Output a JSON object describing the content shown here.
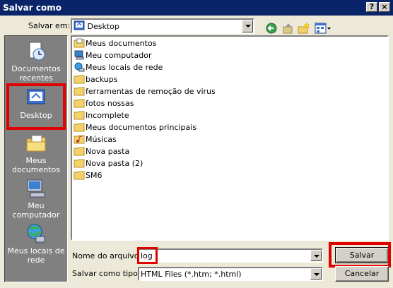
{
  "window": {
    "title": "Salvar como",
    "help_label": "?",
    "close_label": "×"
  },
  "savein": {
    "label": "Salvar em:",
    "value": "Desktop",
    "value_icon": "desktop-icon"
  },
  "toolbar": {
    "icons": [
      "back-icon",
      "up-folder-icon",
      "new-folder-icon",
      "view-menu-icon"
    ]
  },
  "places": [
    {
      "label": "Documentos recentes",
      "icon": "recent-documents-icon"
    },
    {
      "label": "Desktop",
      "icon": "desktop-icon"
    },
    {
      "label": "Meus documentos",
      "icon": "my-documents-icon"
    },
    {
      "label": "Meu computador",
      "icon": "my-computer-icon"
    },
    {
      "label": "Meus locais de rede",
      "icon": "network-places-icon"
    }
  ],
  "files": [
    {
      "name": "Meus documentos",
      "icon": "my-documents-icon"
    },
    {
      "name": "Meu computador",
      "icon": "my-computer-icon"
    },
    {
      "name": "Meus locais de rede",
      "icon": "network-places-icon"
    },
    {
      "name": "backups",
      "icon": "folder-icon"
    },
    {
      "name": "ferramentas de remoção de virus",
      "icon": "folder-icon"
    },
    {
      "name": "fotos nossas",
      "icon": "folder-icon"
    },
    {
      "name": "Incomplete",
      "icon": "folder-icon"
    },
    {
      "name": "Meus documentos principais",
      "icon": "folder-icon"
    },
    {
      "name": "Músicas",
      "icon": "music-folder-icon"
    },
    {
      "name": "Nova pasta",
      "icon": "folder-icon"
    },
    {
      "name": "Nova pasta (2)",
      "icon": "folder-icon"
    },
    {
      "name": "SM6",
      "icon": "folder-icon"
    }
  ],
  "filename": {
    "label": "Nome do arquivo:",
    "value": "log"
  },
  "filetype": {
    "label": "Salvar como tipo:",
    "value": "HTML Files (*.htm; *.html)"
  },
  "buttons": {
    "save": "Salvar",
    "cancel": "Cancelar"
  },
  "colors": {
    "titlebar": "#0a246a",
    "dialog_bg": "#ece9d8",
    "places_bg": "#808080",
    "highlight": "#e00000",
    "folder": "#f4d26a"
  }
}
